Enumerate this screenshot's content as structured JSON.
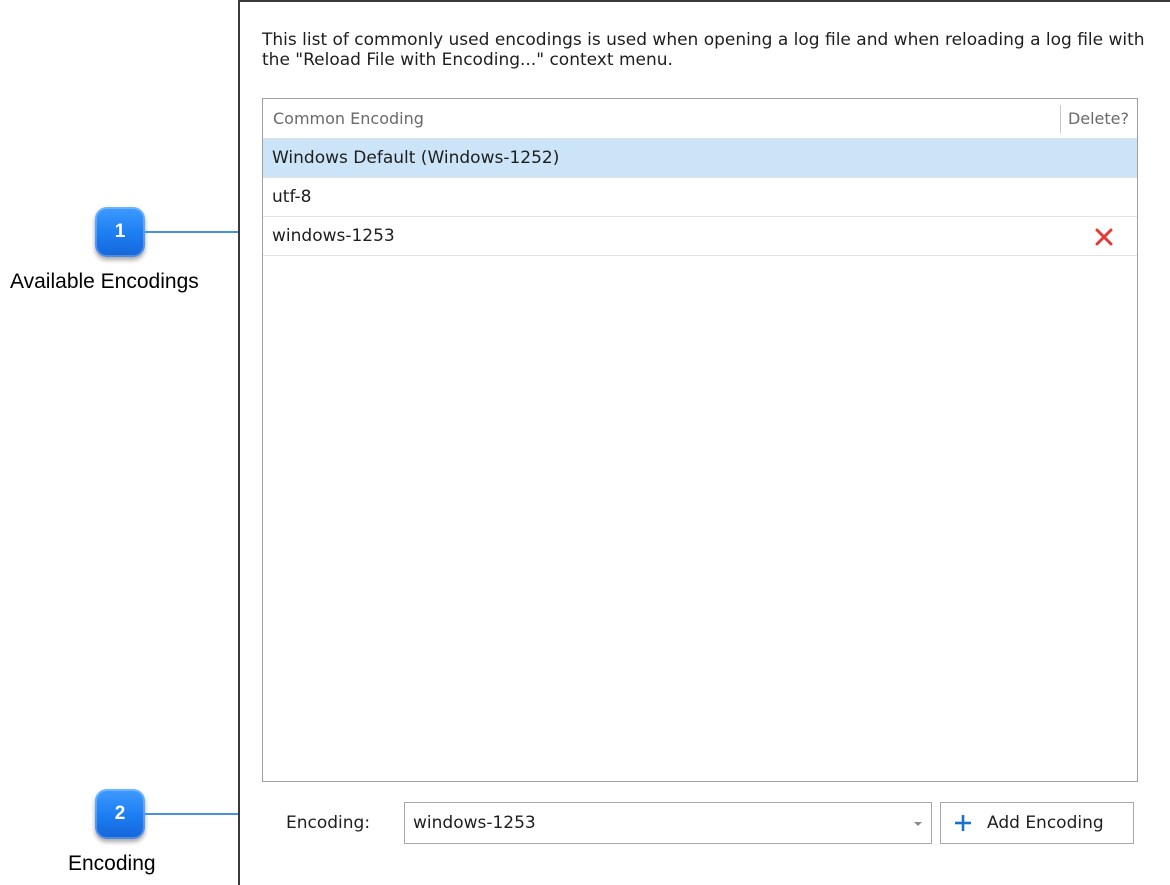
{
  "callouts": [
    {
      "number": "1",
      "label": "Available Encodings"
    },
    {
      "number": "2",
      "label": "Encoding"
    }
  ],
  "description": "This list of commonly used encodings is used when opening a log file and when reloading a log file with the \"Reload File with Encoding...\" context menu.",
  "encodings_table": {
    "columns": [
      "Common Encoding",
      "Delete?"
    ],
    "rows": [
      {
        "name": "Windows Default (Windows-1252)",
        "selected": true,
        "deletable": false
      },
      {
        "name": "utf-8",
        "selected": false,
        "deletable": false
      },
      {
        "name": "windows-1253",
        "selected": false,
        "deletable": true
      }
    ]
  },
  "encoding_field": {
    "label": "Encoding:",
    "value": "windows-1253"
  },
  "add_button": {
    "label": "Add Encoding",
    "icon": "plus-icon"
  },
  "colors": {
    "callout_badge": "#1c7df2",
    "callout_line": "#4a90e2",
    "selected_row": "#cce4f7",
    "delete_icon": "#e53935",
    "plus_icon": "#1c6fd1"
  }
}
